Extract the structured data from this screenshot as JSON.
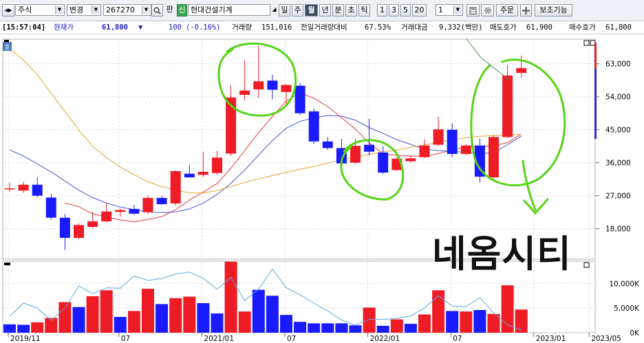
{
  "toolbar": {
    "market": "주식",
    "change_mode": "변경",
    "code": "267270",
    "pan_label": "판",
    "sin_badge": "신",
    "stock_name": "현대건설기계",
    "period_buttons": [
      "일",
      "주",
      "월",
      "년",
      "분",
      "초",
      "틱"
    ],
    "selected_period": "월",
    "interval_buttons": [
      "1",
      "3",
      "5",
      "20"
    ],
    "count_value": "1",
    "order_label": "주문",
    "aux_label": "보조기능"
  },
  "status": {
    "time": "[15:57:04]",
    "current_label": "현재가",
    "current_price": "61,800",
    "change_arrow": "▼",
    "change": "100",
    "change_pct": "(-0.16%)",
    "volume_label": "거래량",
    "volume": "151,016",
    "prev_ratio_label": "전일거래량대비",
    "prev_ratio": "67.53%",
    "amount_label": "거래대금",
    "amount": "9,332(백만)",
    "ask_label": "매도호가",
    "ask": "61,900",
    "bid_label": "매수호가",
    "bid": "61,800"
  },
  "chart_panel": {
    "tab_label": "호"
  },
  "overlay_text": "네옴시티",
  "chart_data": [
    {
      "type": "candlestick",
      "period": "monthly",
      "y_ticks": [
        63000,
        54000,
        45000,
        36000,
        27000,
        18000
      ],
      "y_tick_labels": [
        "63,000",
        "54,000",
        "45,000",
        "36,000",
        "27,000",
        "18,000"
      ],
      "ylim": [
        9700,
        69700
      ],
      "x_labels": [
        "2019/11",
        "07",
        "2021/01",
        "07",
        "2022/01",
        "07",
        "2023/01",
        "2023/05"
      ],
      "candles": [
        {
          "o": 29000,
          "h": 30600,
          "l": 28200,
          "c": 29000
        },
        {
          "o": 28400,
          "h": 30800,
          "l": 27800,
          "c": 30000
        },
        {
          "o": 30000,
          "h": 32000,
          "l": 26500,
          "c": 27000
        },
        {
          "o": 26500,
          "h": 27500,
          "l": 20500,
          "c": 21000
        },
        {
          "o": 21000,
          "h": 22000,
          "l": 12200,
          "c": 15500
        },
        {
          "o": 15500,
          "h": 19500,
          "l": 15200,
          "c": 19000
        },
        {
          "o": 18500,
          "h": 22600,
          "l": 18200,
          "c": 20000
        },
        {
          "o": 20000,
          "h": 25000,
          "l": 19700,
          "c": 22700
        },
        {
          "o": 22600,
          "h": 23500,
          "l": 21300,
          "c": 23100
        },
        {
          "o": 23400,
          "h": 24500,
          "l": 21700,
          "c": 22100
        },
        {
          "o": 22500,
          "h": 27000,
          "l": 22000,
          "c": 26400
        },
        {
          "o": 26400,
          "h": 26900,
          "l": 24500,
          "c": 24700
        },
        {
          "o": 24900,
          "h": 34000,
          "l": 24300,
          "c": 33700
        },
        {
          "o": 33000,
          "h": 35400,
          "l": 32000,
          "c": 32000
        },
        {
          "o": 32700,
          "h": 39000,
          "l": 32200,
          "c": 33500
        },
        {
          "o": 33200,
          "h": 39200,
          "l": 32800,
          "c": 37400
        },
        {
          "o": 38500,
          "h": 57200,
          "l": 37800,
          "c": 53800
        },
        {
          "o": 54500,
          "h": 64000,
          "l": 53000,
          "c": 55700
        },
        {
          "o": 56000,
          "h": 68000,
          "l": 53700,
          "c": 58200
        },
        {
          "o": 58400,
          "h": 60000,
          "l": 53300,
          "c": 55900
        },
        {
          "o": 55300,
          "h": 57500,
          "l": 51900,
          "c": 57200
        },
        {
          "o": 57000,
          "h": 57700,
          "l": 49000,
          "c": 49500
        },
        {
          "o": 50000,
          "h": 50800,
          "l": 41100,
          "c": 41800
        },
        {
          "o": 41800,
          "h": 43000,
          "l": 39500,
          "c": 40000
        },
        {
          "o": 40000,
          "h": 42500,
          "l": 35800,
          "c": 35800
        },
        {
          "o": 36000,
          "h": 42400,
          "l": 35700,
          "c": 40600
        },
        {
          "o": 40900,
          "h": 48000,
          "l": 38000,
          "c": 39000
        },
        {
          "o": 38800,
          "h": 40500,
          "l": 33000,
          "c": 33300
        },
        {
          "o": 34000,
          "h": 37600,
          "l": 33800,
          "c": 37100
        },
        {
          "o": 36400,
          "h": 38000,
          "l": 36000,
          "c": 37200
        },
        {
          "o": 37500,
          "h": 42400,
          "l": 37300,
          "c": 40700
        },
        {
          "o": 40900,
          "h": 48500,
          "l": 40500,
          "c": 45100
        },
        {
          "o": 45000,
          "h": 46800,
          "l": 37500,
          "c": 38400
        },
        {
          "o": 38400,
          "h": 41000,
          "l": 38000,
          "c": 40700
        },
        {
          "o": 40700,
          "h": 42600,
          "l": 30600,
          "c": 32200
        },
        {
          "o": 32000,
          "h": 43500,
          "l": 31500,
          "c": 43000
        },
        {
          "o": 43000,
          "h": 62600,
          "l": 42700,
          "c": 59800
        },
        {
          "o": 60500,
          "h": 65200,
          "l": 59300,
          "c": 61800
        }
      ],
      "ma_series": [
        {
          "color": "#e33a3a",
          "values": [
            null,
            null,
            null,
            null,
            25000,
            24000,
            22100,
            21200,
            20400,
            19900,
            20500,
            21300,
            23200,
            25800,
            28000,
            30300,
            34500,
            39300,
            44200,
            48600,
            52800,
            55100,
            53600,
            51300,
            48300,
            45200,
            41400,
            38400,
            38000,
            37800,
            37800,
            38500,
            39500,
            40300,
            40600,
            40500,
            41500,
            43800
          ]
        },
        {
          "color": "#4a52d6",
          "values": [
            39500,
            37800,
            35700,
            33500,
            31000,
            28500,
            26500,
            25000,
            23900,
            23200,
            22600,
            22400,
            22600,
            23400,
            25000,
            27300,
            30400,
            34000,
            38100,
            42000,
            45400,
            47300,
            48200,
            48900,
            48700,
            47600,
            45600,
            44000,
            42300,
            41000,
            39700,
            39300,
            39100,
            38800,
            38500,
            38700,
            40900,
            43300
          ]
        },
        {
          "color": "#e8a030",
          "values": [
            67000,
            64000,
            60000,
            55000,
            50000,
            45000,
            40500,
            37400,
            34800,
            32700,
            30800,
            29500,
            28500,
            27800,
            27700,
            28400,
            29500,
            30600,
            31600,
            32500,
            33400,
            34200,
            35000,
            35900,
            36800,
            37500,
            38300,
            39000,
            39500,
            40200,
            40800,
            41600,
            42300,
            42800,
            43200,
            43400,
            43600,
            43700
          ]
        }
      ]
    },
    {
      "type": "bar",
      "name": "volume",
      "y_ticks": [
        0,
        5000,
        10000
      ],
      "y_tick_labels": [
        "0K",
        "5,000K",
        "10,000K"
      ],
      "ylim": [
        0,
        14500
      ],
      "values": [
        1700,
        1600,
        2100,
        3000,
        6200,
        5200,
        7400,
        8600,
        3200,
        4400,
        8900,
        5800,
        7000,
        7300,
        6000,
        3900,
        14400,
        4300,
        8700,
        7500,
        3600,
        2200,
        1900,
        1900,
        1900,
        1500,
        5100,
        1400,
        2700,
        1800,
        3700,
        8600,
        4400,
        4300,
        4600,
        3800,
        9600,
        4700
      ],
      "colors": [
        "blue",
        "blue",
        "red",
        "red",
        "red",
        "blue",
        "red",
        "red",
        "blue",
        "red",
        "red",
        "blue",
        "red",
        "red",
        "blue",
        "blue",
        "red",
        "red",
        "blue",
        "blue",
        "blue",
        "blue",
        "blue",
        "blue",
        "blue",
        "blue",
        "red",
        "blue",
        "red",
        "blue",
        "red",
        "red",
        "blue",
        "red",
        "blue",
        "red",
        "red",
        "red"
      ],
      "line_color": "#5aa8e8",
      "line_values": [
        3300,
        6000,
        5000,
        2500,
        5000,
        9500,
        7900,
        9100,
        9000,
        11500,
        10600,
        11000,
        11900,
        12300,
        11000,
        8800,
        11200,
        6500,
        8800,
        12900,
        9100,
        7700,
        6000,
        4400,
        2600,
        1500,
        2700,
        2700,
        2900,
        3400,
        5000,
        7500,
        5400,
        5300,
        7100,
        4000,
        1600,
        500
      ]
    }
  ]
}
